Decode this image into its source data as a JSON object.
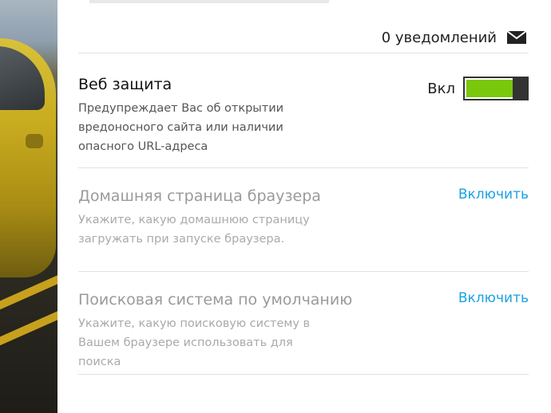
{
  "header": {
    "notifications_text": "0 уведомлений",
    "mail_icon": "envelope-icon"
  },
  "settings": [
    {
      "title": "Веб защита",
      "description": "Предупреждает Вас об открытии вредоносного сайта или наличии опасного URL-адреса",
      "state": "enabled",
      "toggle_label": "Вкл",
      "toggle_on_fraction": 0.78,
      "toggle_color": "#7ac70c"
    },
    {
      "title": "Домашняя страница браузера",
      "description": "Укажите, какую домашнюю страницу загружать при запуске браузера.",
      "state": "disabled",
      "action_label": "Включить"
    },
    {
      "title": "Поисковая система по умолчанию",
      "description": "Укажите, какую поисковую систему в Вашем браузере использовать для поиска",
      "state": "disabled",
      "action_label": "Включить"
    }
  ],
  "colors": {
    "accent_link": "#1ba1e2",
    "toggle_on": "#7ac70c",
    "disabled_text": "#9a9a9a"
  }
}
